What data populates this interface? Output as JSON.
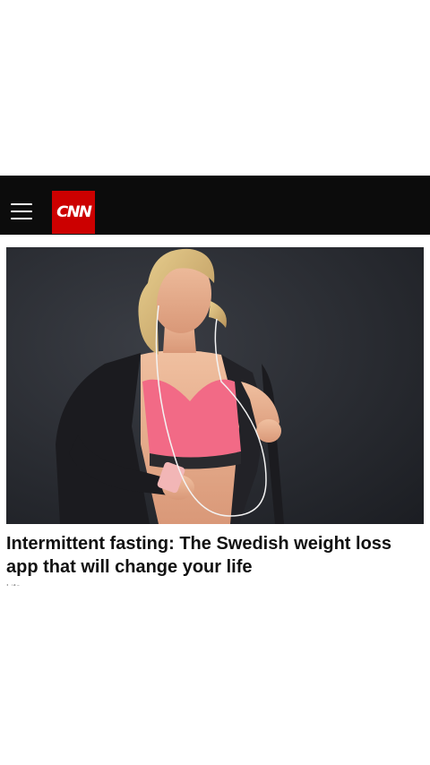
{
  "header": {
    "menu_icon": "hamburger-menu-icon",
    "logo_text": "CNN",
    "background_color": "#0c0c0c",
    "logo_color": "#cc0000"
  },
  "article": {
    "image_alt": "Woman running with earphones",
    "headline": "Intermittent fasting: The Swedish weight loss app that will change your life",
    "byline": "Life"
  }
}
